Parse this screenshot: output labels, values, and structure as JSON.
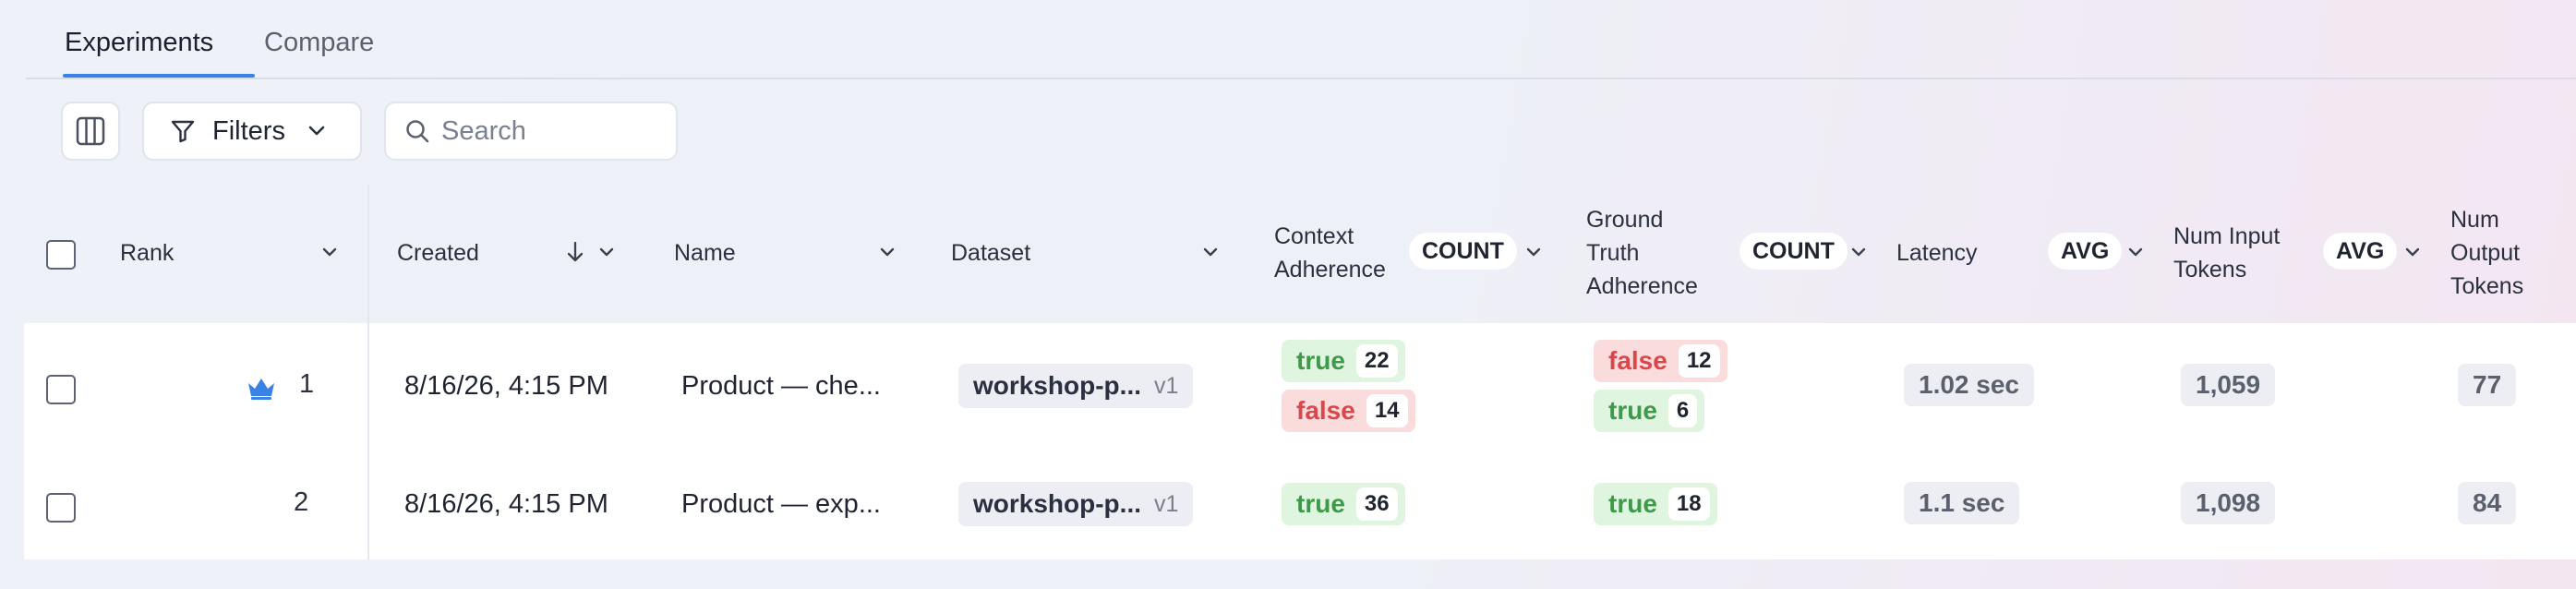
{
  "tabs": [
    {
      "label": "Experiments",
      "active": true
    },
    {
      "label": "Compare",
      "active": false
    }
  ],
  "toolbar": {
    "filters_label": "Filters",
    "search_placeholder": "Search"
  },
  "columns": {
    "rank": "Rank",
    "created": "Created",
    "name": "Name",
    "dataset": "Dataset",
    "context_adherence": [
      "Context",
      "Adherence"
    ],
    "context_adherence_agg": "COUNT",
    "ground_truth_adherence": [
      "Ground",
      "Truth",
      "Adherence"
    ],
    "ground_truth_adherence_agg": "COUNT",
    "latency": "Latency",
    "latency_agg": "AVG",
    "num_input_tokens": [
      "Num Input",
      "Tokens"
    ],
    "num_input_tokens_agg": "AVG",
    "num_output_tokens": [
      "Num",
      "Output",
      "Tokens"
    ]
  },
  "rows": [
    {
      "rank": "1",
      "top_ranked": true,
      "created": "8/16/26, 4:15 PM",
      "name": "Product — che...",
      "dataset": "workshop-p...",
      "dataset_version": "v1",
      "context_adherence": [
        {
          "label": "true",
          "count": "22"
        },
        {
          "label": "false",
          "count": "14"
        }
      ],
      "ground_truth_adherence": [
        {
          "label": "false",
          "count": "12"
        },
        {
          "label": "true",
          "count": "6"
        }
      ],
      "latency": "1.02 sec",
      "num_input_tokens": "1,059",
      "num_output_tokens": "77"
    },
    {
      "rank": "2",
      "top_ranked": false,
      "created": "8/16/26, 4:15 PM",
      "name": "Product — exp...",
      "dataset": "workshop-p...",
      "dataset_version": "v1",
      "context_adherence": [
        {
          "label": "true",
          "count": "36"
        }
      ],
      "ground_truth_adherence": [
        {
          "label": "true",
          "count": "18"
        }
      ],
      "latency": "1.1 sec",
      "num_input_tokens": "1,098",
      "num_output_tokens": "84"
    }
  ],
  "colors": {
    "accent": "#3a82e6",
    "true_bg": "#dff5e0",
    "true_text": "#3e9a4a",
    "false_bg": "#fbdcdc",
    "false_text": "#d9474a",
    "crown": "#3a82e6"
  },
  "icons": {
    "columns": "columns-icon",
    "filter": "filter-icon",
    "search": "search-icon",
    "chevron": "chevron-down-icon",
    "sort": "arrow-down-icon",
    "crown": "crown-icon"
  }
}
